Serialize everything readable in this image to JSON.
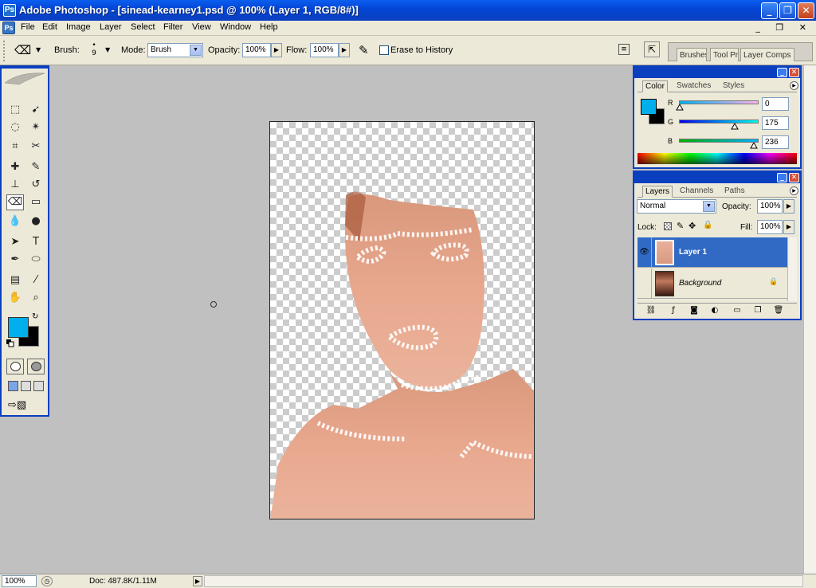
{
  "window": {
    "title": "Adobe Photoshop - [sinead-kearney1.psd @ 100% (Layer 1, RGB/8#)]",
    "minimize": "_",
    "restore": "❐",
    "close": "✕"
  },
  "menu": {
    "items": [
      "File",
      "Edit",
      "Image",
      "Layer",
      "Select",
      "Filter",
      "View",
      "Window",
      "Help"
    ],
    "doc_controls": "_ ❐ ✕"
  },
  "options": {
    "brush_label": "Brush:",
    "brush_size": "9",
    "mode_label": "Mode:",
    "mode_value": "Brush",
    "opacity_label": "Opacity:",
    "opacity_value": "100%",
    "flow_label": "Flow:",
    "flow_value": "100%",
    "erase_history_label": "Erase to History",
    "well_tabs": [
      "Brushes",
      "Tool Pr",
      "Layer Comps"
    ]
  },
  "toolbox": {
    "foreground_color": "#00afec",
    "background_color": "#000000"
  },
  "color_palette": {
    "tabs": [
      "Color",
      "Swatches",
      "Styles"
    ],
    "active_tab": "Color",
    "r_label": "R",
    "g_label": "G",
    "b_label": "B",
    "r_value": "0",
    "g_value": "175",
    "b_value": "236"
  },
  "layers_palette": {
    "tabs": [
      "Layers",
      "Channels",
      "Paths"
    ],
    "active_tab": "Layers",
    "blend_mode": "Normal",
    "opacity_label": "Opacity:",
    "opacity_value": "100%",
    "lock_label": "Lock:",
    "fill_label": "Fill:",
    "fill_value": "100%",
    "layers": [
      {
        "name": "Layer 1",
        "selected": true,
        "visible": true
      },
      {
        "name": "Background",
        "selected": false,
        "visible": false,
        "locked": true
      }
    ]
  },
  "status": {
    "zoom": "100%",
    "doc_info": "Doc: 487.8K/1.11M"
  }
}
